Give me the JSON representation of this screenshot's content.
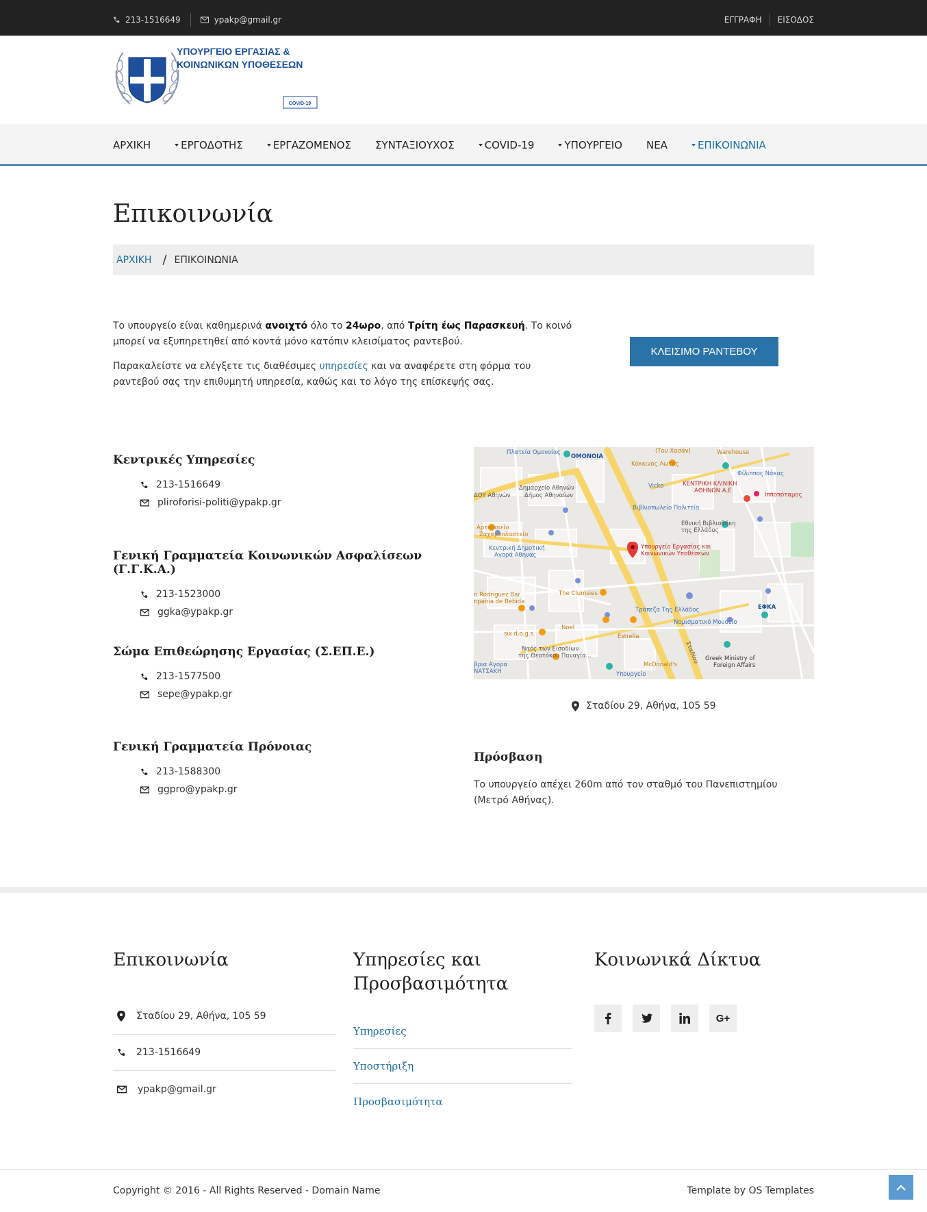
{
  "topbar": {
    "phone": "213-1516649",
    "email": "ypakp@gmail.gr",
    "register": "ΕΓΓΡΑΦΗ",
    "login": "ΕΙΣΟΔΟΣ"
  },
  "logo": {
    "line1": "ΥΠΟΥΡΓΕΙΟ ΕΡΓΑΣΙΑΣ &",
    "line2": "ΚΟΙΝΩΝΙΚΩΝ ΥΠΟΘΕΣΕΩΝ",
    "badge": "COVID-19"
  },
  "nav": [
    {
      "label": "ΑΡΧΙΚΗ",
      "dropdown": false,
      "active": false
    },
    {
      "label": "ΕΡΓΟΔΟΤΗΣ",
      "dropdown": true,
      "active": false
    },
    {
      "label": "ΕΡΓΑΖΟΜΕΝΟΣ",
      "dropdown": true,
      "active": false
    },
    {
      "label": "ΣΥΝΤΑΞΙΟΥΧΟΣ",
      "dropdown": false,
      "active": false
    },
    {
      "label": "COVID-19",
      "dropdown": true,
      "active": false
    },
    {
      "label": "ΥΠΟΥΡΓΕΙΟ",
      "dropdown": true,
      "active": false
    },
    {
      "label": "ΝΕΑ",
      "dropdown": false,
      "active": false
    },
    {
      "label": "ΕΠΙΚΟΙΝΩΝΙΑ",
      "dropdown": true,
      "active": true
    }
  ],
  "page": {
    "title": "Επικοινωνία",
    "breadcrumb_home": "ΑΡΧΙΚΗ",
    "breadcrumb_sep": "/",
    "breadcrumb_current": "ΕΠΙΚΟΙΝΩΝΙΑ"
  },
  "intro": {
    "p1_a": "Το υπουργείο είναι καθημερινά ",
    "p1_b": "ανοιχτό",
    "p1_c": " όλο το ",
    "p1_d": "24ωρο",
    "p1_e": ", από ",
    "p1_f": "Τρίτη έως Παρασκευή",
    "p1_g": ". Το κοινό μπορεί να εξυπηρετηθεί από κοντά μόνο κατόπιν κλεισίματος ραντεβού.",
    "p2_a": "Παρακαλείστε να ελέγξετε τις διαθέσιμες ",
    "p2_link": "υπηρεσίες",
    "p2_b": " και να αναφέρετε στη φόρμα του ραντεβού σας την επιθυμητή υπηρεσία, καθώς και το λόγο της επίσκεψής σας.",
    "button": "ΚΛΕΙΣΙΜΟ ΡΑΝΤΕΒΟΥ"
  },
  "services": [
    {
      "title": "Κεντρικές Υπηρεσίες",
      "phone": "213-1516649",
      "email": "pliroforisi-politi@ypakp.gr"
    },
    {
      "title": "Γενική Γραμματεία Κοινωνικών Ασφαλίσεων (Γ.Γ.Κ.Α.)",
      "phone": "213-1523000",
      "email": "ggka@ypakp.gr"
    },
    {
      "title": "Σώμα Επιθεώρησης Εργασίας (Σ.ΕΠ.Ε.)",
      "phone": "213-1577500",
      "email": "sepe@ypakp.gr"
    },
    {
      "title": "Γενική Γραμματεία Πρόνοιας",
      "phone": "213-1588300",
      "email": "ggpro@ypakp.gr"
    }
  ],
  "map": {
    "labels": {
      "omonia_sq": "Πλατεία Ομονοίας",
      "omonia": "ΟΜΟΝΟΙΑ",
      "tou_xasan": "(Του Χασάν)",
      "warehouse": "Warehouse",
      "kokkinos": "Κόκκινος Λωτός",
      "filippos": "Φίλιππος Νάκας",
      "dimarxeio1": "Δημαρχείο Αθηνών",
      "dimarxeio2": "Δήμος Αθηναίων",
      "vicko": "Vicko",
      "kliniki1": "ΚΕΝΤΡΙΚΗ ΚΛΙΝΙΚΗ",
      "kliniki2": "ΑΘΗΝΩΝ Α.Ε",
      "ippopotamos": "Ιπποπόταμος",
      "vivlio": "Βιβλιοπωλείο Πολιτεία",
      "artopoieio1": "Αρτοποιείο",
      "artopoieio2": "Ζαχαροπλαστείο",
      "ethniki1": "Εθνική Βιβλιοθήκη",
      "ethniki2": "της Ελλάδος",
      "agora1": "Κεντρική Δημοτική",
      "agora2": "Αγορά Αθηνας",
      "ministry1": "Υπουργείο Εργασίας και",
      "ministry2": "Κοινωνικών Υποθέσεων",
      "rodriguez1": "n Rodriguez Bar",
      "rodriguez2": "npania de Bebida",
      "clumsies": "The Clumsies",
      "trapeza": "Τράπεζα Της Ελλάδος",
      "efka": "ΕΦΚΑ",
      "noel": "Noel",
      "nomismatiko": "Νομισματικό Μουσείο",
      "sixdogs": "six d.o.g.s",
      "estrella": "Estrella",
      "naos1": "Ναός των Εισοδίων",
      "naos2": "της Θεοτόκου Παναγία...",
      "agora_b1": "βρια Αγορα",
      "agora_b2": "ΝΑΤΣΑΚΗ",
      "mcdonalds": "McDonald's",
      "greek_min1": "Greek Ministry of",
      "greek_min2": "Foreign Affairs",
      "ypourgeio": "Υπουργείο",
      "stadiou": "Σταδίου",
      "dou": "ΔΟΥ Αθηνών"
    }
  },
  "address": "Σταδίου 29, Αθήνα, 105 59",
  "access": {
    "title": "Πρόσβαση",
    "text": "Το υπουργείο απέχει 260m από τον σταθμό του Πανεπιστημίου (Μετρό Αθήνας)."
  },
  "footer": {
    "contact_title": "Επικοινωνία",
    "contact_address": "Σταδίου 29, Αθήνα, 105 59",
    "contact_phone": "213-1516649",
    "contact_email": "ypakp@gmail.gr",
    "services_title": "Υπηρεσίες και Προσβασιμότητα",
    "services_links": [
      "Υπηρεσίες",
      "Υποστήριξη",
      "Προσβασιμότητα"
    ],
    "social_title": "Κοινωνικά Δίκτυα",
    "social": [
      "facebook-icon",
      "twitter-icon",
      "linkedin-icon",
      "google-plus-icon"
    ],
    "social_gplus": "G+",
    "copyright": "Copyright © 2016 - All Rights Reserved - Domain Name",
    "credit": "Template by OS Templates"
  },
  "colors": {
    "accent": "#1d6fa5",
    "button": "#2a73a8",
    "topbar": "#222222",
    "totop": "#5b9bd1"
  }
}
